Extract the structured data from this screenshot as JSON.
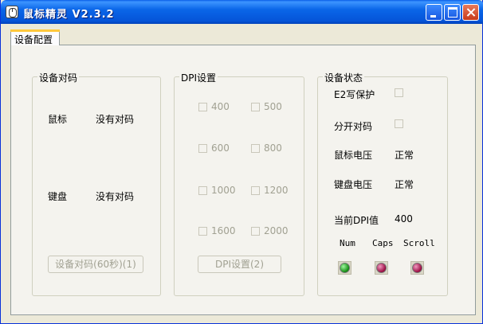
{
  "window": {
    "title": "鼠标精灵 V2.3.2"
  },
  "tabs": [
    {
      "label": "设备配置",
      "active": true
    }
  ],
  "pairing_group": {
    "legend": "设备对码",
    "mouse_label": "鼠标",
    "mouse_status": "没有对码",
    "keyboard_label": "键盘",
    "keyboard_status": "没有对码",
    "pair_button": "设备对码(60秒)(1)"
  },
  "dpi_group": {
    "legend": "DPI设置",
    "options": [
      {
        "value": "400",
        "checked": false
      },
      {
        "value": "500",
        "checked": false
      },
      {
        "value": "600",
        "checked": false
      },
      {
        "value": "800",
        "checked": false
      },
      {
        "value": "1000",
        "checked": false
      },
      {
        "value": "1200",
        "checked": false
      },
      {
        "value": "1600",
        "checked": false
      },
      {
        "value": "2000",
        "checked": false
      }
    ],
    "set_button": "DPI设置(2)"
  },
  "status_group": {
    "legend": "设备状态",
    "e2_label": "E2写保护",
    "e2_checked": false,
    "split_label": "分开对码",
    "split_checked": false,
    "mouse_voltage_label": "鼠标电压",
    "mouse_voltage_value": "正常",
    "keyboard_voltage_label": "键盘电压",
    "keyboard_voltage_value": "正常",
    "dpi_label": "当前DPI值",
    "dpi_value": "400",
    "indicators": [
      {
        "label": "Num",
        "color": "#108A10"
      },
      {
        "label": "Caps",
        "color": "#9A0A40"
      },
      {
        "label": "Scroll",
        "color": "#9A0A40"
      }
    ]
  }
}
